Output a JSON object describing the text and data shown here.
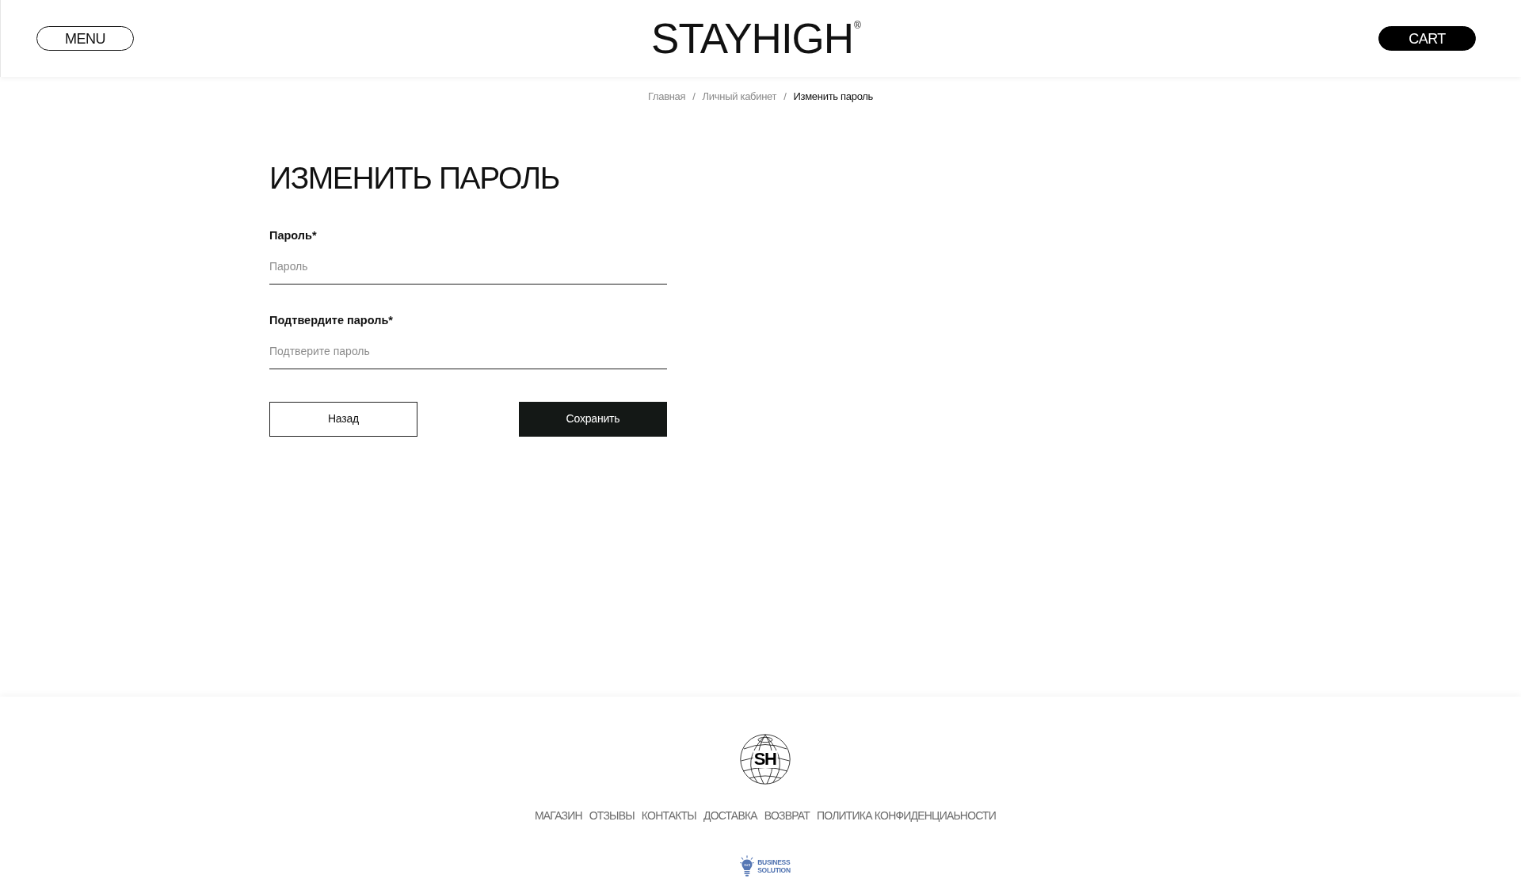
{
  "header": {
    "menu_button": {
      "label": "MENU"
    },
    "logo": {
      "text": "STAYHIGH$^{®}$"
    },
    "cart_button": {
      "label": "CART"
    }
  },
  "breadcrumbs": [
    {
      "label": "Главная",
      "current": false,
      "separator": "/"
    },
    {
      "label": "Личный кабинет",
      "current": false,
      "separator": "/"
    },
    {
      "label": "Изменить пароль",
      "current": true
    }
  ],
  "page_title": "ИЗМЕНИТЬ ПАРОЛЬ",
  "form": {
    "fields": [
      {
        "label": "Пароль*",
        "placeholder": "Пароль"
      },
      {
        "label": "Подтвердите пароль*",
        "placeholder": "Подтверите пароль"
      }
    ],
    "buttons": [
      {
        "label": "Назад",
        "kind": "outline"
      },
      {
        "label": "Сохранить",
        "kind": "filled"
      }
    ]
  },
  "footer": {
    "logo": {
      "text": "SH"
    },
    "links": [
      "МАГАЗИН",
      "ОТЗЫВЫ",
      "КОНТАКТЫ",
      "ДОСТАВКА",
      "ВОЗВРАТ",
      "ПОЛИТИКА КОНФИДЕНЦИАЬНОСТИ"
    ],
    "credit": {
      "lines": [
        "BUSINESS",
        "SOLUTION"
      ]
    }
  }
}
